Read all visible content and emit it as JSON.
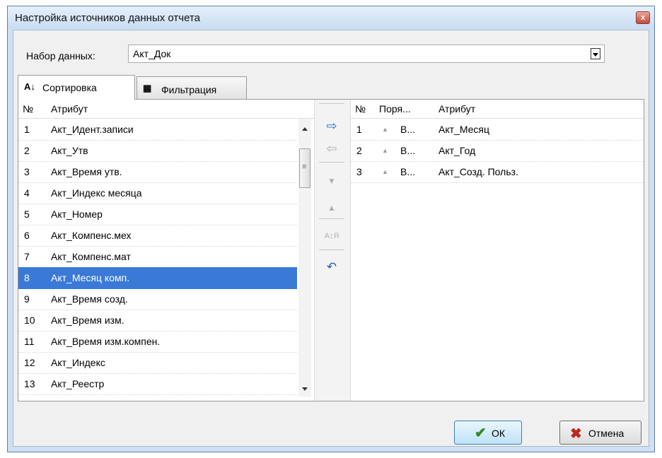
{
  "window": {
    "title": "Настройка источников данных отчета",
    "close_label": "x"
  },
  "dataset": {
    "label": "Набор данных:",
    "value": "Акт_Док"
  },
  "tabs": [
    {
      "label": "Сортировка",
      "icon": "sort-az-icon"
    },
    {
      "label": "Фильтрация",
      "icon": "filter-table-icon"
    }
  ],
  "left_grid": {
    "headers": [
      "№",
      "Атрибут"
    ],
    "rows": [
      {
        "n": "1",
        "attr": "Акт_Идент.записи"
      },
      {
        "n": "2",
        "attr": "Акт_Утв"
      },
      {
        "n": "3",
        "attr": "Акт_Время утв."
      },
      {
        "n": "4",
        "attr": "Акт_Индекс месяца"
      },
      {
        "n": "5",
        "attr": "Акт_Номер"
      },
      {
        "n": "6",
        "attr": "Акт_Компенс.мех"
      },
      {
        "n": "7",
        "attr": "Акт_Компенс.мат"
      },
      {
        "n": "8",
        "attr": "Акт_Месяц комп."
      },
      {
        "n": "9",
        "attr": "Акт_Время созд."
      },
      {
        "n": "10",
        "attr": "Акт_Время изм."
      },
      {
        "n": "11",
        "attr": "Акт_Время изм.компен."
      },
      {
        "n": "12",
        "attr": "Акт_Индекс"
      },
      {
        "n": "13",
        "attr": "Акт_Реестр"
      }
    ],
    "selected_row": "8"
  },
  "toolbar": {
    "add": "⇨",
    "remove": "⇦",
    "move_down": "▼",
    "move_up": "▲",
    "toggle_order": "A↕Я",
    "reset": "↶"
  },
  "right_grid": {
    "headers": [
      "№",
      "Поря...",
      "Атрибут"
    ],
    "rows": [
      {
        "n": "1",
        "order_icon": "▲",
        "order": "В...",
        "attr": "Акт_Месяц"
      },
      {
        "n": "2",
        "order_icon": "▲",
        "order": "В...",
        "attr": "Акт_Год"
      },
      {
        "n": "3",
        "order_icon": "▲",
        "order": "В...",
        "attr": "Акт_Созд. Польз."
      }
    ]
  },
  "buttons": {
    "ok": "ОК",
    "cancel": "Отмена"
  }
}
